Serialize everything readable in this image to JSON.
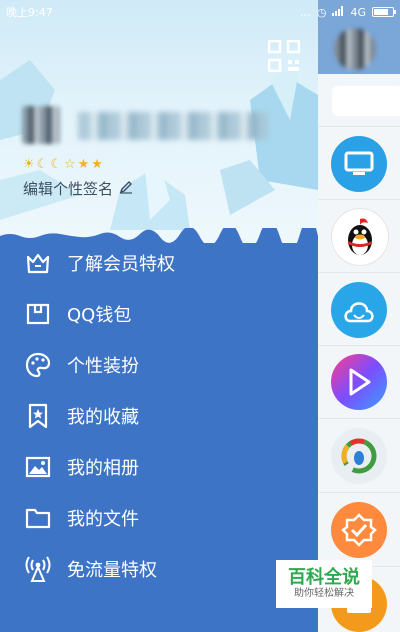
{
  "status_bar": {
    "time": "晚上9:47",
    "network": "4G",
    "icons": [
      "more-dots-icon",
      "alarm-icon",
      "signal-icon",
      "battery-icon"
    ],
    "battery_level": 0.8
  },
  "profile": {
    "level_badges": [
      "☀",
      "☾",
      "☾",
      "☆",
      "★",
      "★"
    ],
    "signature_label": "编辑个性签名",
    "qr_icon": "qr-code-icon"
  },
  "menu": {
    "items": [
      {
        "label": "了解会员特权",
        "icon": "crown-icon"
      },
      {
        "label": "QQ钱包",
        "icon": "wallet-icon"
      },
      {
        "label": "个性装扮",
        "icon": "palette-icon"
      },
      {
        "label": "我的收藏",
        "icon": "bookmark-star-icon"
      },
      {
        "label": "我的相册",
        "icon": "photo-icon"
      },
      {
        "label": "我的文件",
        "icon": "folder-icon"
      },
      {
        "label": "免流量特权",
        "icon": "antenna-icon"
      }
    ]
  },
  "side_apps": [
    "monitor-app-icon",
    "qq-penguin-app-icon",
    "cloud-app-icon",
    "video-play-app-icon",
    "news-app-icon",
    "check-badge-app-icon",
    "orange-app-icon"
  ],
  "watermark": {
    "title": "百科全说",
    "subtitle": "助你轻松解决"
  },
  "colors": {
    "drawer_bg": "#3e74c6",
    "header_bg": "#dcf0f9",
    "app_blue": "#2e9de4",
    "watermark_green": "#2fa84f"
  }
}
